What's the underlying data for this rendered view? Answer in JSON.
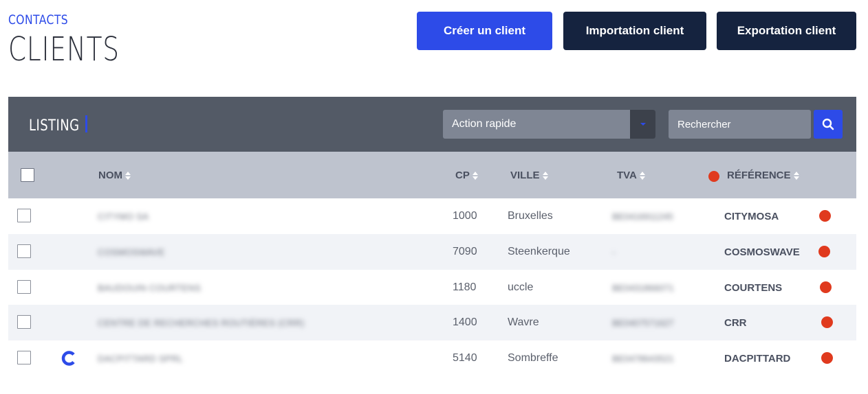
{
  "header": {
    "breadcrumb": "CONTACTS",
    "title": "CLIENTS"
  },
  "toolbar": {
    "create_label": "Créer un client",
    "import_label": "Importation client",
    "export_label": "Exportation client"
  },
  "panel": {
    "title": "LISTING",
    "quick_action": "Action rapide",
    "search_placeholder": "Rechercher",
    "icons": {
      "search": "search-icon",
      "caret": "chevron-down-icon"
    }
  },
  "table": {
    "columns": {
      "nom": "NOM",
      "cp": "CP",
      "ville": "VILLE",
      "tva": "TVA",
      "reference": "RÉFÉRENCE"
    },
    "rows": [
      {
        "nom": "CITYMO SA",
        "cp": "1000",
        "ville": "Bruxelles",
        "tva": "BE0416911245",
        "reference": "CITYMOSA",
        "status_color": "#e03a1e"
      },
      {
        "nom": "COSMOSWAVE",
        "cp": "7090",
        "ville": "Steenkerque",
        "tva": "-",
        "reference": "COSMOSWAVE",
        "status_color": "#e03a1e"
      },
      {
        "nom": "BAUDOUIN COURTENS",
        "cp": "1180",
        "ville": "uccle",
        "tva": "BE0431866071",
        "reference": "COURTENS",
        "status_color": "#e03a1e"
      },
      {
        "nom": "CENTRE DE RECHERCHES ROUTIÈRES (CRR)",
        "cp": "1400",
        "ville": "Wavre",
        "tva": "BE0407571627",
        "reference": "CRR",
        "status_color": "#e03a1e"
      },
      {
        "nom": "DACPITTARD SPRL",
        "cp": "5140",
        "ville": "Sombreffe",
        "tva": "BE0478643521",
        "reference": "DACPITTARD",
        "status_color": "#e03a1e"
      }
    ]
  },
  "colors": {
    "accent": "#2d4be8",
    "navy": "#15233f",
    "panel": "#535a66",
    "header_row": "#bec3ce",
    "status_red": "#e03a1e"
  }
}
